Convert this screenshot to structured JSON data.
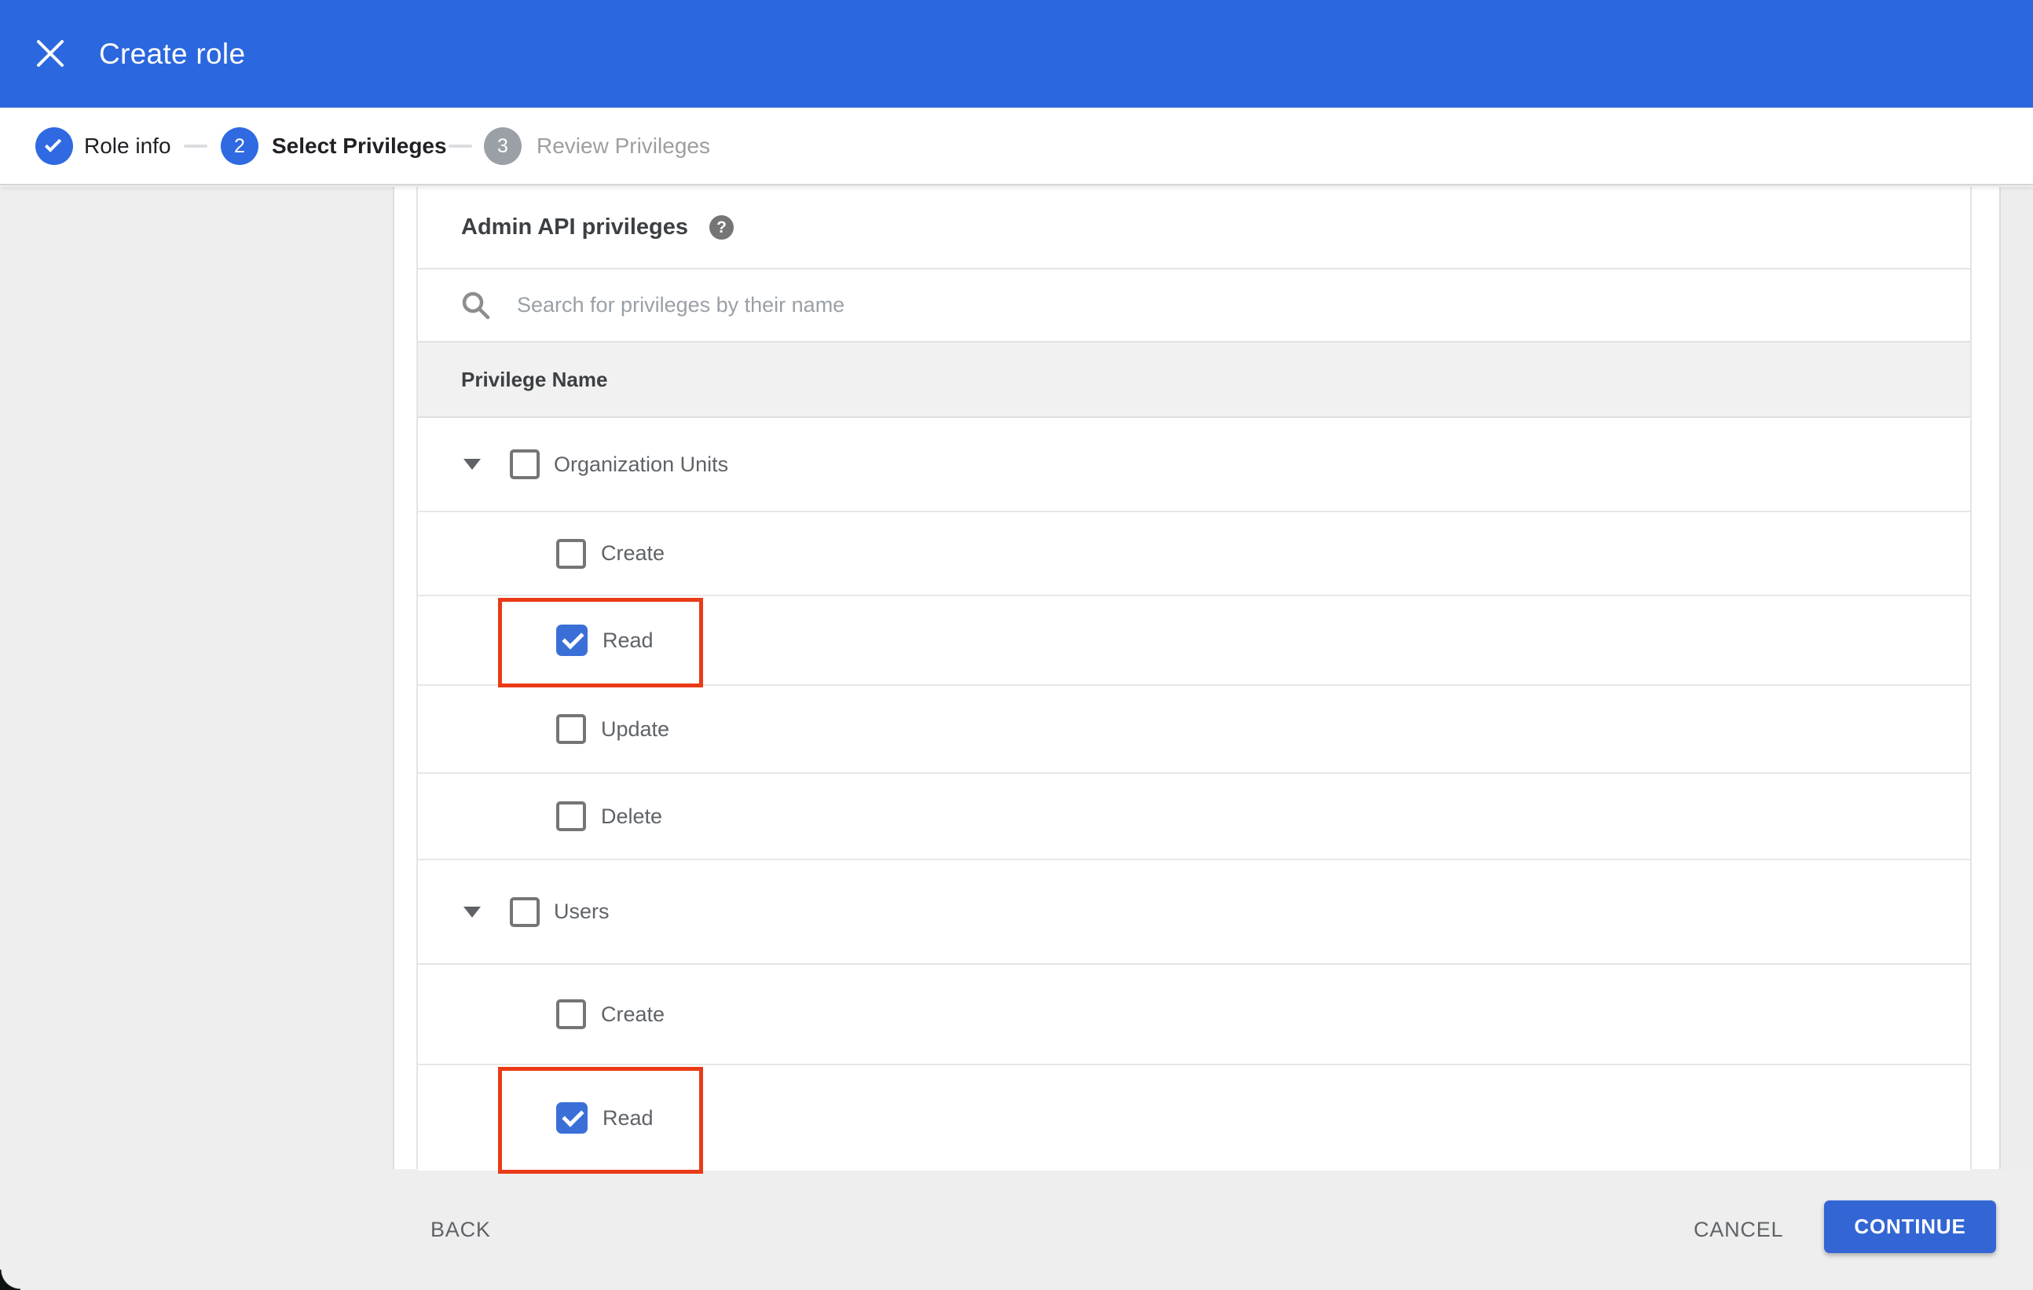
{
  "header": {
    "title": "Create role"
  },
  "stepper": {
    "steps": [
      {
        "label": "Role info",
        "state": "complete"
      },
      {
        "label": "Select Privileges",
        "number": "2",
        "state": "active"
      },
      {
        "label": "Review Privileges",
        "number": "3",
        "state": "inactive"
      }
    ]
  },
  "panel": {
    "heading": "Admin API privileges",
    "help_icon": "?",
    "search_placeholder": "Search for privileges by their name",
    "column_header": "Privilege Name"
  },
  "privileges": [
    {
      "label": "Organization Units",
      "level": "parent",
      "expanded": true,
      "checked": false,
      "highlighted": false
    },
    {
      "label": "Create",
      "level": "child",
      "expanded": false,
      "checked": false,
      "highlighted": false
    },
    {
      "label": "Read",
      "level": "child",
      "expanded": false,
      "checked": true,
      "highlighted": true
    },
    {
      "label": "Update",
      "level": "child",
      "expanded": false,
      "checked": false,
      "highlighted": false
    },
    {
      "label": "Delete",
      "level": "child",
      "expanded": false,
      "checked": false,
      "highlighted": false
    },
    {
      "label": "Users",
      "level": "parent",
      "expanded": true,
      "checked": false,
      "highlighted": false
    },
    {
      "label": "Create",
      "level": "child",
      "expanded": false,
      "checked": false,
      "highlighted": false
    },
    {
      "label": "Read",
      "level": "child",
      "expanded": false,
      "checked": true,
      "highlighted": true
    }
  ],
  "footer": {
    "back": "BACK",
    "cancel": "CANCEL",
    "continue": "CONTINUE"
  },
  "colors": {
    "header_blue": "#2b67de",
    "step_circle_blue": "#2f6ae2",
    "step_circle_gray": "#9aa0a6",
    "checkbox_blue": "#3b6fd8",
    "continue_blue": "#3366d4",
    "highlight_red": "#ea3a17",
    "page_gray": "#eeeeee",
    "header_row_gray": "#f1f1f1",
    "row_border": "#e6e6e6",
    "text_dark": "#202124",
    "text_gray": "#5f6368",
    "placeholder_gray": "#9aa0a6"
  }
}
